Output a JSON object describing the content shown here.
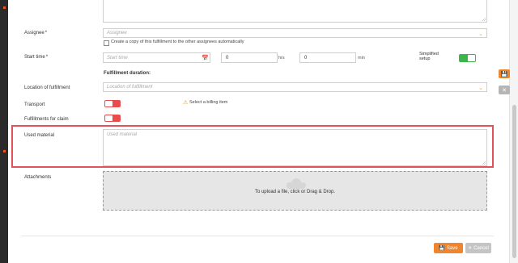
{
  "form": {
    "assignee": {
      "label": "Assignee",
      "required_mark": "*",
      "placeholder": "Assignee"
    },
    "copy_checkbox": {
      "label": "Create a copy of this fulfillment to the other assignees automatically",
      "checked": false
    },
    "start_time": {
      "label": "Start time",
      "required_mark": "*",
      "placeholder": "Start time",
      "hrs_value": "0",
      "hrs_unit": "hrs",
      "min_value": "0",
      "min_unit": "min"
    },
    "simplified_setup": {
      "label_line1": "Simplified",
      "label_line2": "setup",
      "on": true
    },
    "fulfillment_duration": {
      "label": "Fulfillment duration:"
    },
    "location": {
      "label": "Location of fulfillment",
      "placeholder": "Location of fulfillment"
    },
    "transport": {
      "label": "Transport",
      "on": false
    },
    "billing_notice": {
      "text": "Select a billing item"
    },
    "fulfillments_for_claim": {
      "label": "Fulfillments for claim",
      "on": false
    },
    "used_material": {
      "label": "Used material",
      "placeholder": "Used material"
    },
    "attachments": {
      "label": "Attachments",
      "dropzone_text": "To upload a file, click or Drag & Drop."
    }
  },
  "actions": {
    "save_label": "Save",
    "cancel_label": "Cancel"
  },
  "colors": {
    "accent": "#f0852d",
    "toggle_on": "#3cb54a",
    "toggle_off": "#e84c4c",
    "highlight": "#e0525c"
  },
  "icons": {
    "calendar": "calendar-icon",
    "warning": "warning-icon",
    "upload": "cloud-upload-icon",
    "save": "floppy-icon",
    "cancel": "close-icon"
  }
}
